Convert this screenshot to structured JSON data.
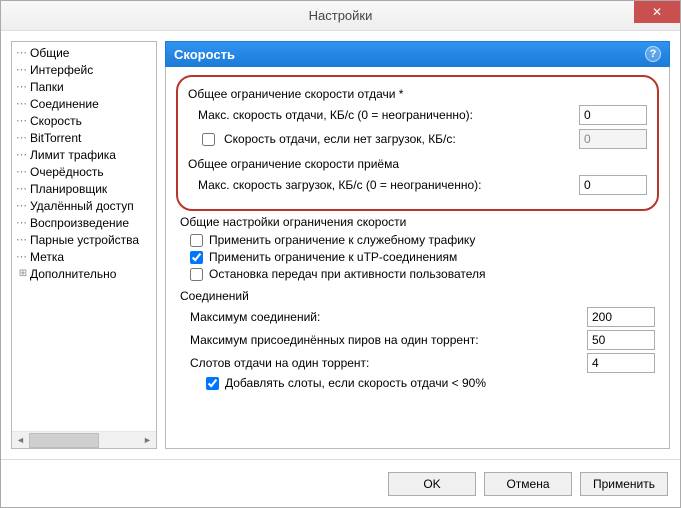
{
  "window": {
    "title": "Настройки",
    "close_glyph": "✕"
  },
  "sidebar": {
    "items": [
      {
        "label": "Общие",
        "glyph": "dots"
      },
      {
        "label": "Интерфейс",
        "glyph": "dots"
      },
      {
        "label": "Папки",
        "glyph": "dots"
      },
      {
        "label": "Соединение",
        "glyph": "dots"
      },
      {
        "label": "Скорость",
        "glyph": "dots"
      },
      {
        "label": "BitTorrent",
        "glyph": "dots"
      },
      {
        "label": "Лимит трафика",
        "glyph": "dots"
      },
      {
        "label": "Очерёдность",
        "glyph": "dots"
      },
      {
        "label": "Планировщик",
        "glyph": "dots"
      },
      {
        "label": "Удалённый доступ",
        "glyph": "dots"
      },
      {
        "label": "Воспроизведение",
        "glyph": "dots"
      },
      {
        "label": "Парные устройства",
        "glyph": "dots"
      },
      {
        "label": "Метка",
        "glyph": "dots"
      },
      {
        "label": "Дополнительно",
        "glyph": "plus"
      }
    ]
  },
  "header": {
    "title": "Скорость",
    "help": "?"
  },
  "upload": {
    "group": "Общее ограничение скорости отдачи *",
    "max_label": "Макс. скорость отдачи, КБ/с (0 = неограниченно):",
    "max_value": "0",
    "alt_label": "Скорость отдачи, если нет загрузок, КБ/с:",
    "alt_value": "0",
    "alt_checked": false
  },
  "download": {
    "group": "Общее ограничение скорости приёма",
    "max_label": "Макс. скорость загрузок, КБ/с (0 = неограниченно):",
    "max_value": "0"
  },
  "common": {
    "group": "Общие настройки ограничения скорости",
    "cb1_label": "Применить ограничение к служебному трафику",
    "cb1_checked": false,
    "cb2_label": "Применить ограничение к uTP-соединениям",
    "cb2_checked": true,
    "cb3_label": "Остановка передач при активности пользователя",
    "cb3_checked": false
  },
  "connections": {
    "group": "Соединений",
    "max_conn_label": "Максимум соединений:",
    "max_conn_value": "200",
    "peers_label": "Максимум присоединённых пиров на один торрент:",
    "peers_value": "50",
    "slots_label": "Слотов отдачи на один торрент:",
    "slots_value": "4",
    "add_slots_label": "Добавлять слоты, если скорость отдачи < 90%",
    "add_slots_checked": true
  },
  "buttons": {
    "ok": "OK",
    "cancel": "Отмена",
    "apply": "Применить"
  }
}
